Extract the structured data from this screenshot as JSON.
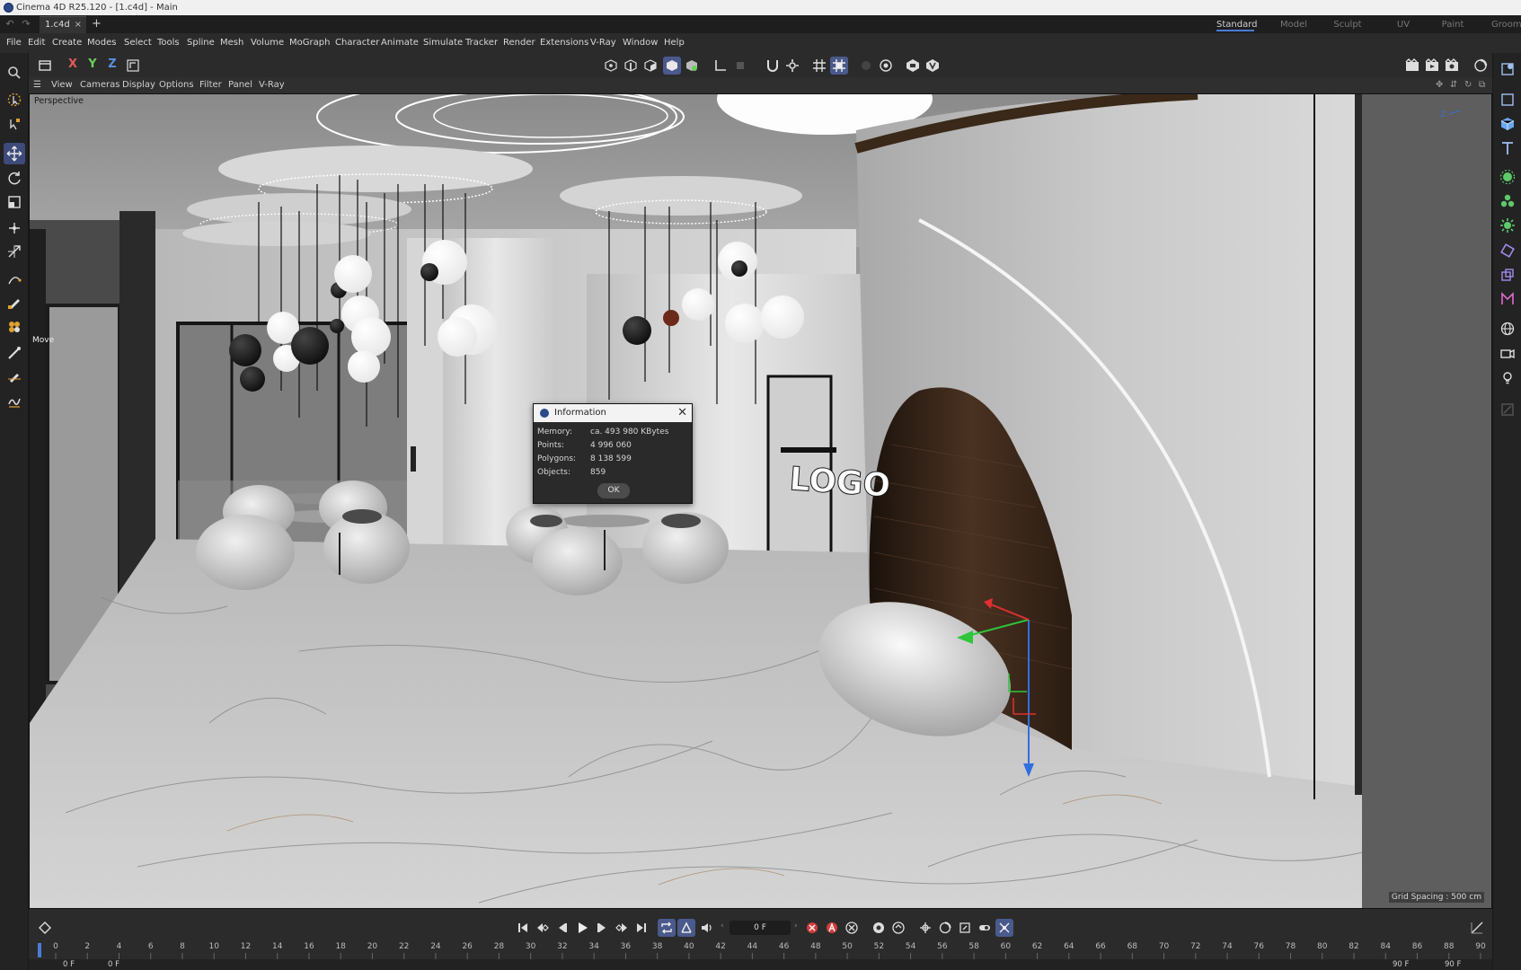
{
  "window": {
    "title": "Cinema 4D R25.120 - [1.c4d] - Main"
  },
  "tabs": {
    "document": "1.c4d",
    "close": "×",
    "add": "+"
  },
  "layouts": [
    "Standard",
    "Model",
    "Sculpt",
    "UV Edit",
    "Paint",
    "Groom"
  ],
  "menu": [
    "File",
    "Edit",
    "Create",
    "Modes",
    "Select",
    "Tools",
    "Spline",
    "Mesh",
    "Volume",
    "MoGraph",
    "Character",
    "Animate",
    "Simulate",
    "Tracker",
    "Render",
    "Extensions",
    "V-Ray",
    "Window",
    "Help"
  ],
  "axes": {
    "x": "X",
    "y": "Y",
    "z": "Z"
  },
  "viewport": {
    "menu": [
      "View",
      "Cameras",
      "Display",
      "Options",
      "Filter",
      "Panel",
      "V-Ray"
    ],
    "camera": "Perspective",
    "tool_hint": "Move",
    "grid_spacing": "Grid Spacing : 500 cm",
    "logo_text": "LOGO"
  },
  "info_dialog": {
    "title": "Information",
    "rows": [
      {
        "label": "Memory:",
        "value": "ca. 493 980 KBytes"
      },
      {
        "label": "Points:",
        "value": "4 996 060"
      },
      {
        "label": "Polygons:",
        "value": "8 138 599"
      },
      {
        "label": "Objects:",
        "value": "859"
      }
    ],
    "ok": "OK"
  },
  "playback": {
    "frame": "0 F"
  },
  "timeline": {
    "ticks": [
      "0",
      "2",
      "4",
      "6",
      "8",
      "10",
      "12",
      "14",
      "16",
      "18",
      "20",
      "22",
      "24",
      "26",
      "28",
      "30",
      "32",
      "34",
      "36",
      "38",
      "40",
      "42",
      "44",
      "46",
      "48",
      "50",
      "52",
      "54",
      "56",
      "58",
      "60",
      "62",
      "64",
      "66",
      "68",
      "70",
      "72",
      "74",
      "76",
      "78",
      "80",
      "82",
      "84",
      "86",
      "88",
      "90"
    ],
    "start": "0 F",
    "start2": "0 F",
    "end": "90 F",
    "end2": "90 F"
  },
  "colors": {
    "accent": "#4a7bd6",
    "active_tool": "#3d4a7a",
    "x_axis": "#e05a5a",
    "y_axis": "#6ccf5a",
    "z_axis": "#5a8fe0",
    "record": "#d33c3c"
  }
}
